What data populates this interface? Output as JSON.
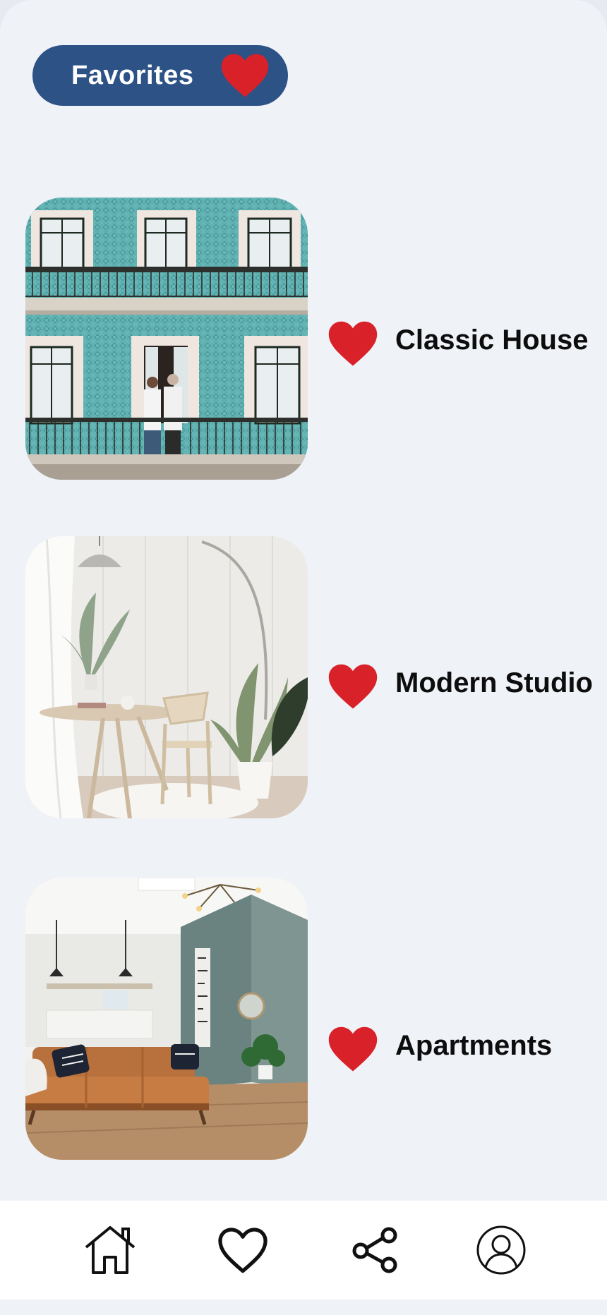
{
  "header": {
    "title": "Favorites",
    "heart_icon": "heart-icon",
    "pill_color": "#2d5286",
    "heart_color": "#d82128"
  },
  "favorites": [
    {
      "title": "Classic House",
      "photo": "tiled-facade-with-balconies",
      "icon": "heart-icon"
    },
    {
      "title": "Modern Studio",
      "photo": "white-room-with-table-and-plant",
      "icon": "heart-icon"
    },
    {
      "title": "Apartments",
      "photo": "living-room-with-leather-sofa",
      "icon": "heart-icon"
    }
  ],
  "bottom_nav": {
    "items": [
      {
        "icon": "home-icon"
      },
      {
        "icon": "heart-outline-icon"
      },
      {
        "icon": "share-icon"
      },
      {
        "icon": "profile-icon"
      }
    ]
  }
}
